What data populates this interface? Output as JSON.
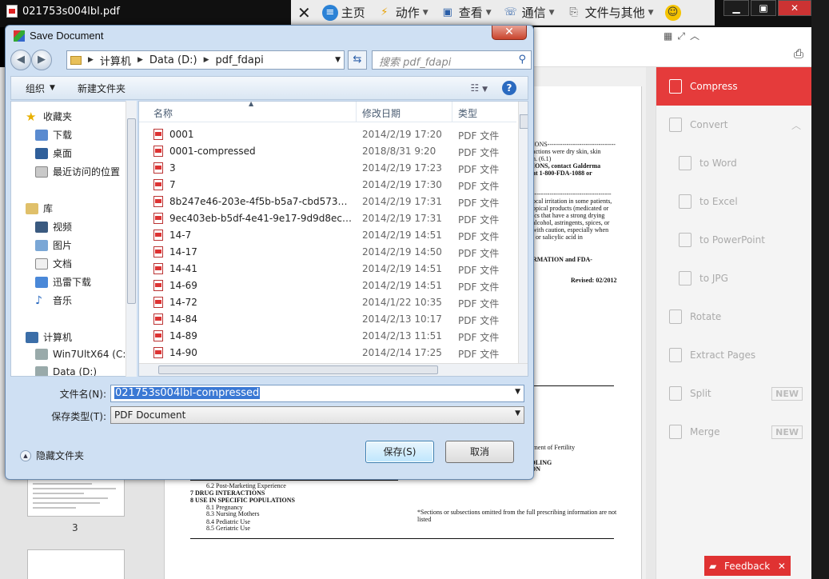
{
  "app": {
    "title": "021753s004lbl.pdf",
    "toolbar": [
      {
        "label": "主页",
        "icon": "home-icon"
      },
      {
        "label": "动作",
        "icon": "lightning-icon"
      },
      {
        "label": "查看",
        "icon": "monitor-icon"
      },
      {
        "label": "通信",
        "icon": "phone-icon"
      },
      {
        "label": "文件与其他",
        "icon": "file-icon"
      }
    ],
    "right_panel": {
      "items": [
        {
          "label": "Compress",
          "active": true,
          "sub": false,
          "badge": ""
        },
        {
          "label": "Convert",
          "active": false,
          "sub": false,
          "badge": ""
        },
        {
          "label": "to Word",
          "active": false,
          "sub": true,
          "badge": ""
        },
        {
          "label": "to Excel",
          "active": false,
          "sub": true,
          "badge": ""
        },
        {
          "label": "to PowerPoint",
          "active": false,
          "sub": true,
          "badge": ""
        },
        {
          "label": "to JPG",
          "active": false,
          "sub": true,
          "badge": ""
        },
        {
          "label": "Rotate",
          "active": false,
          "sub": false,
          "badge": ""
        },
        {
          "label": "Extract Pages",
          "active": false,
          "sub": false,
          "badge": ""
        },
        {
          "label": "Split",
          "active": false,
          "sub": false,
          "badge": "NEW"
        },
        {
          "label": "Merge",
          "active": false,
          "sub": false,
          "badge": "NEW"
        }
      ]
    },
    "feedback_label": "Feedback",
    "thumb_page_label": "3",
    "document_lines": [
      "IONS--------------------------------",
      "actions were dry skin, skin",
      "n. (6.1)",
      "IONS, contact Galderma",
      "at 1-800-FDA-1088 or",
      "-------------------------------------",
      "ocal irritation in some patients,",
      "opical products (medicated or",
      "ics that have a strong drying",
      "alcohol, astringents, spices, or",
      "with caution, especially when",
      ", or salicylic acid in",
      "RMATION and FDA-",
      "Revised: 02/2012",
      "rment of Fertility",
      "DLING",
      "ON",
      "6.2    Post-Marketing Experience",
      "7    DRUG INTERACTIONS",
      "8    USE IN SPECIFIC POPULATIONS",
      "8.1    Pregnancy",
      "8.3    Nursing Mothers",
      "8.4    Pediatric Use",
      "8.5    Geriatric Use",
      "*Sections or subsections omitted from the full prescribing information are not",
      "listed"
    ]
  },
  "dialog": {
    "title": "Save Document",
    "breadcrumb": [
      "计算机",
      "Data (D:)",
      "pdf_fdapi"
    ],
    "search_placeholder": "搜索 pdf_fdapi",
    "organize_label": "组织",
    "new_folder_label": "新建文件夹",
    "nav_items": [
      {
        "label": "收藏夹",
        "group": true,
        "icon": "star-icon"
      },
      {
        "label": "下载",
        "group": false,
        "icon": "download-folder-icon"
      },
      {
        "label": "桌面",
        "group": false,
        "icon": "desktop-icon"
      },
      {
        "label": "最近访问的位置",
        "group": false,
        "icon": "recent-places-icon"
      },
      {
        "label": "库",
        "group": true,
        "icon": "library-icon"
      },
      {
        "label": "视频",
        "group": false,
        "icon": "video-icon"
      },
      {
        "label": "图片",
        "group": false,
        "icon": "pictures-icon"
      },
      {
        "label": "文档",
        "group": false,
        "icon": "documents-icon"
      },
      {
        "label": "迅雷下载",
        "group": false,
        "icon": "thunder-icon"
      },
      {
        "label": "音乐",
        "group": false,
        "icon": "music-icon"
      },
      {
        "label": "计算机",
        "group": true,
        "icon": "computer-icon"
      },
      {
        "label": "Win7UltX64 (C:)",
        "group": false,
        "icon": "drive-icon"
      },
      {
        "label": "Data (D:)",
        "group": false,
        "icon": "drive-icon"
      }
    ],
    "columns": {
      "name": "名称",
      "date": "修改日期",
      "type": "类型"
    },
    "files": [
      {
        "name": "0001",
        "date": "2014/2/19 17:20",
        "type": "PDF 文件"
      },
      {
        "name": "0001-compressed",
        "date": "2018/8/31 9:20",
        "type": "PDF 文件"
      },
      {
        "name": "3",
        "date": "2014/2/19 17:23",
        "type": "PDF 文件"
      },
      {
        "name": "7",
        "date": "2014/2/19 17:30",
        "type": "PDF 文件"
      },
      {
        "name": "8b247e46-203e-4f5b-b5a7-cbd57341...",
        "date": "2014/2/19 17:31",
        "type": "PDF 文件"
      },
      {
        "name": "9ec403eb-b5df-4e41-9e17-9d9d8eca...",
        "date": "2014/2/19 17:31",
        "type": "PDF 文件"
      },
      {
        "name": "14-7",
        "date": "2014/2/19 14:51",
        "type": "PDF 文件"
      },
      {
        "name": "14-17",
        "date": "2014/2/19 14:50",
        "type": "PDF 文件"
      },
      {
        "name": "14-41",
        "date": "2014/2/19 14:51",
        "type": "PDF 文件"
      },
      {
        "name": "14-69",
        "date": "2014/2/19 14:51",
        "type": "PDF 文件"
      },
      {
        "name": "14-72",
        "date": "2014/1/22 10:35",
        "type": "PDF 文件"
      },
      {
        "name": "14-84",
        "date": "2014/2/13 10:17",
        "type": "PDF 文件"
      },
      {
        "name": "14-89",
        "date": "2014/2/13 11:51",
        "type": "PDF 文件"
      },
      {
        "name": "14-90",
        "date": "2014/2/14 17:25",
        "type": "PDF 文件"
      }
    ],
    "filename_label": "文件名(N):",
    "filename_value": "021753s004lbl-compressed",
    "filetype_label": "保存类型(T):",
    "filetype_value": "PDF Document",
    "hide_folders_label": "隐藏文件夹",
    "save_label": "保存(S)",
    "cancel_label": "取消"
  }
}
